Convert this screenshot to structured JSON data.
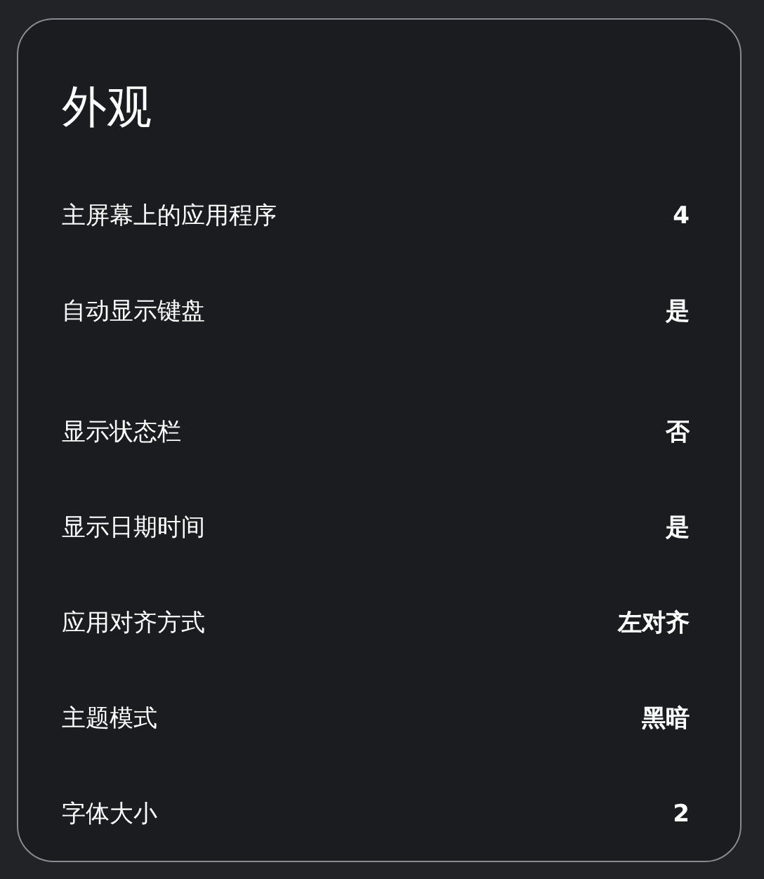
{
  "title": "外观",
  "settings": [
    {
      "label": "主屏幕上的应用程序",
      "value": "4"
    },
    {
      "label": "自动显示键盘",
      "value": "是"
    },
    {
      "label": "显示状态栏",
      "value": "否"
    },
    {
      "label": "显示日期时间",
      "value": "是"
    },
    {
      "label": "应用对齐方式",
      "value": "左对齐"
    },
    {
      "label": "主题模式",
      "value": "黑暗"
    },
    {
      "label": "字体大小",
      "value": "2"
    }
  ]
}
